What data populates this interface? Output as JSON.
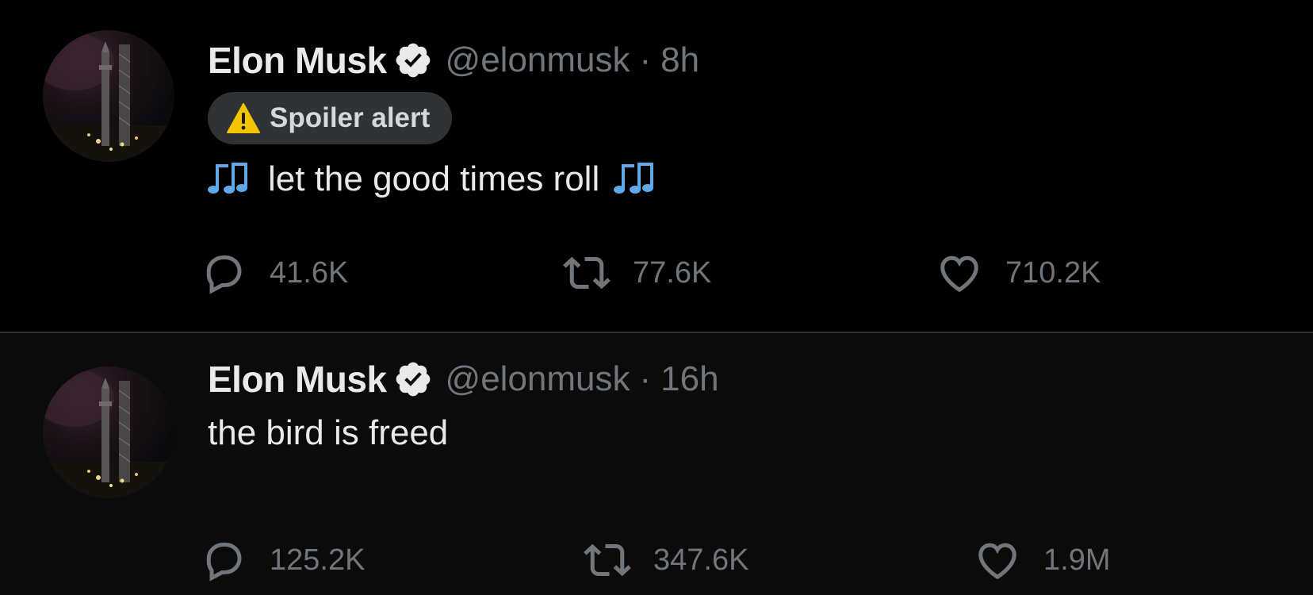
{
  "colors": {
    "background": "#000000",
    "background_alt": "#0b0b0c",
    "text_primary": "#e7e9ea",
    "text_secondary": "#71767b",
    "verified_badge": "#e7e9ea",
    "spoiler_pill": "#2f3336",
    "note_emoji": "#5fa9e8"
  },
  "tweets": [
    {
      "author_name": "Elon Musk",
      "handle": "@elonmusk",
      "separator": "·",
      "time": "8h",
      "verified_icon": "verified-badge-icon",
      "spoiler_label": "Spoiler alert",
      "spoiler_icon": "warning-icon",
      "text": "let the good times roll",
      "text_icons": [
        "musical-notes-icon",
        "musical-notes-icon"
      ],
      "replies": "41.6K",
      "retweets": "77.6K",
      "likes": "710.2K"
    },
    {
      "author_name": "Elon Musk",
      "handle": "@elonmusk",
      "separator": "·",
      "time": "16h",
      "verified_icon": "verified-badge-icon",
      "text": "the bird is freed",
      "replies": "125.2K",
      "retweets": "347.6K",
      "likes": "1.9M"
    }
  ],
  "action_icons": [
    "reply-icon",
    "retweet-icon",
    "like-icon"
  ]
}
